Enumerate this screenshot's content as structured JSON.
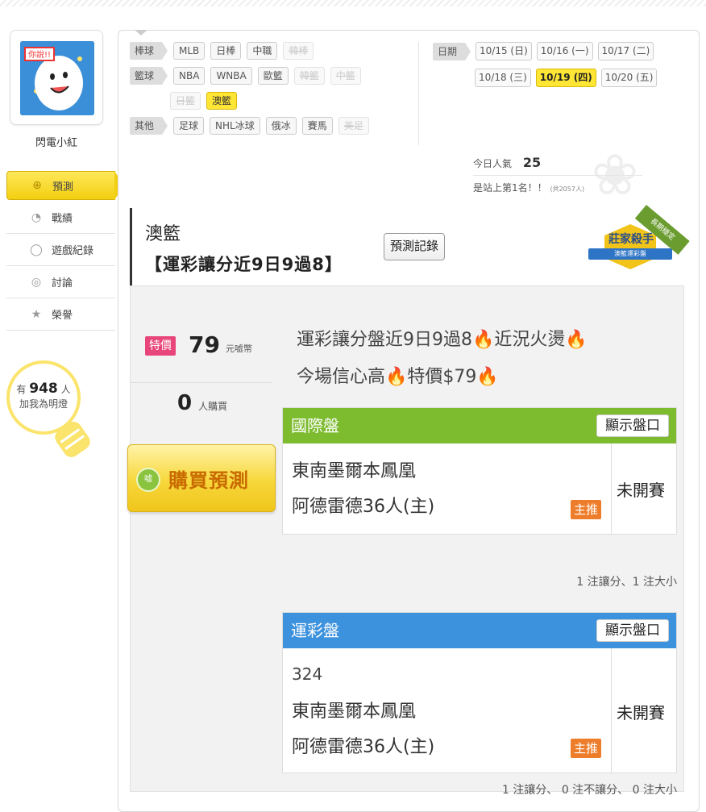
{
  "user": {
    "name": "閃電小紅",
    "avatar_text": "你說!!"
  },
  "nav": [
    {
      "label": "預測",
      "icon": "target-icon",
      "active": true
    },
    {
      "label": "戰績",
      "icon": "chart-icon"
    },
    {
      "label": "遊戲紀錄",
      "icon": "circle-icon"
    },
    {
      "label": "討論",
      "icon": "chat-icon"
    },
    {
      "label": "榮譽",
      "icon": "medal-icon"
    }
  ],
  "fans": {
    "prefix": "有",
    "count": "948",
    "unit": "人",
    "suffix": "加我為明燈"
  },
  "filters": {
    "baseball": {
      "label": "棒球",
      "items": [
        "MLB",
        "日棒",
        "中職",
        "韓棒"
      ]
    },
    "basketball": {
      "label": "籃球",
      "items": [
        "NBA",
        "WNBA",
        "歐籃",
        "韓籃",
        "中籃",
        "日籃",
        "澳籃"
      ]
    },
    "other": {
      "label": "其他",
      "items": [
        "足球",
        "NHL冰球",
        "俄冰",
        "賽馬",
        "美足"
      ]
    }
  },
  "dates": {
    "label": "日期",
    "items": [
      "10/15 (日)",
      "10/16 (一)",
      "10/17 (二)",
      "10/18 (三)",
      "10/19 (四)",
      "10/20 (五)"
    ]
  },
  "popularity": {
    "label": "今日人氣",
    "value": "25",
    "rank_text": "是站上第1名！！",
    "total": "(共2057人)"
  },
  "article": {
    "category": "澳籃",
    "title": "【運彩讓分近9日9過8】",
    "history_button": "預測記錄"
  },
  "badge": {
    "title": "莊家殺手",
    "sub": "澳籃運彩盤",
    "ribbon": "長期穩定"
  },
  "price": {
    "tag": "特價",
    "value": "79",
    "unit": "元嘘幣"
  },
  "buyers": {
    "count": "0",
    "unit": "人購買"
  },
  "buy_button": "購買預測",
  "coin_text": "嘘",
  "description": {
    "line1": "運彩讓分盤近9日9過8🔥近況火燙🔥",
    "line2": "今場信心高🔥特價$79🔥"
  },
  "intl": {
    "title": "國際盤",
    "show_label": "顯示盤口",
    "team1": "東南墨爾本鳳凰",
    "team2": "阿德雷德36人(主)",
    "main_tag": "主推",
    "status": "未開賽",
    "note": "1 注讓分、1 注大小",
    "color": "#7dbb2f"
  },
  "sportslottery": {
    "title": "運彩盤",
    "show_label": "顯示盤口",
    "game_no": "324",
    "team1": "東南墨爾本鳳凰",
    "team2": "阿德雷德36人(主)",
    "main_tag": "主推",
    "status": "未開賽",
    "note": "1 注讓分、 0 注不讓分、 0 注大小",
    "color": "#3d92dd"
  }
}
